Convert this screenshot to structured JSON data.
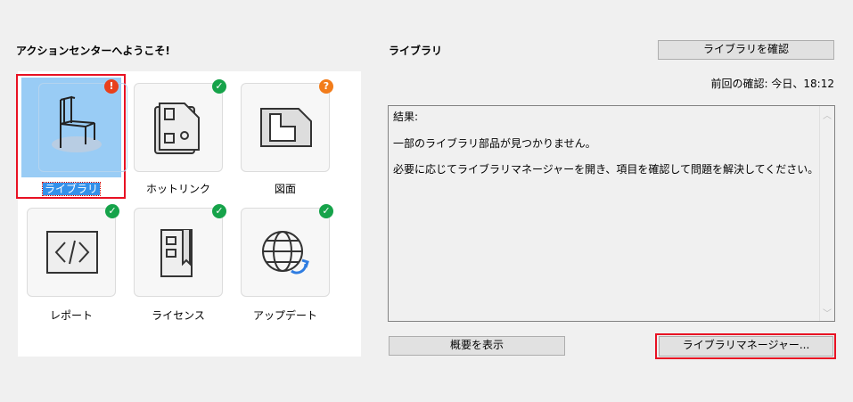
{
  "left": {
    "title": "アクションセンターへようこそ!",
    "tiles": [
      {
        "label": "ライブラリ",
        "icon": "chair-icon",
        "status": "error",
        "badge": "!"
      },
      {
        "label": "ホットリンク",
        "icon": "hotlink-icon",
        "status": "ok",
        "badge": "✓"
      },
      {
        "label": "図面",
        "icon": "drawing-icon",
        "status": "unknown",
        "badge": "?"
      },
      {
        "label": "レポート",
        "icon": "code-icon",
        "status": "ok",
        "badge": "✓"
      },
      {
        "label": "ライセンス",
        "icon": "license-icon",
        "status": "ok",
        "badge": "✓"
      },
      {
        "label": "アップデート",
        "icon": "globe-update-icon",
        "status": "ok",
        "badge": "✓"
      }
    ]
  },
  "right": {
    "title": "ライブラリ",
    "check_button": "ライブラリを確認",
    "last_check": "前回の確認: 今日、18:12",
    "results": [
      "結果:",
      "一部のライブラリ部品が見つかりません。",
      "必要に応じてライブラリマネージャーを開き、項目を確認して問題を解決してください。"
    ],
    "summary_button": "概要を表示",
    "manager_button": "ライブラリマネージャー..."
  },
  "colors": {
    "error": "#e8401c",
    "ok": "#16a34a",
    "unknown": "#f27c1a",
    "selection": "#99ccf5"
  }
}
